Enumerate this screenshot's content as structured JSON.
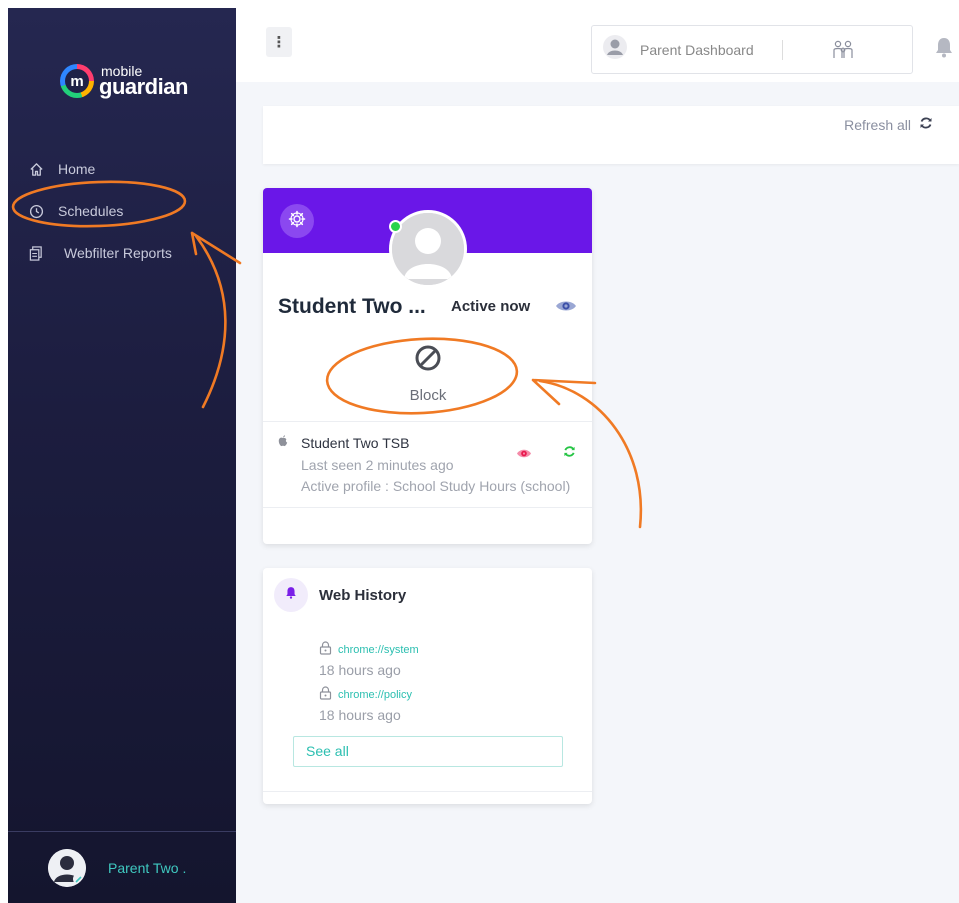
{
  "app": {
    "brand_line1": "mobile",
    "brand_line2": "guardian",
    "brand_mark": "m"
  },
  "sidebar": {
    "items": [
      {
        "label": "Home",
        "icon": "home-icon"
      },
      {
        "label": "Schedules",
        "icon": "clock-icon"
      },
      {
        "label": "Webfilter Reports",
        "icon": "reports-icon"
      }
    ],
    "footer_name": "Parent Two ."
  },
  "topbar": {
    "menu_glyph": "⋮",
    "dashboard_label": "Parent Dashboard"
  },
  "refresh": {
    "label": "Refresh all"
  },
  "student_card": {
    "name": "Student Two ...",
    "status": "Active now",
    "block_label": "Block",
    "device": {
      "name": "Student Two TSB",
      "last_seen": "Last seen 2 minutes ago",
      "active_profile": "Active profile : School Study Hours (school)"
    }
  },
  "web_history": {
    "title": "Web History",
    "items": [
      {
        "url": "chrome://system",
        "time": "18 hours ago"
      },
      {
        "url": "chrome://policy",
        "time": "18 hours ago"
      }
    ],
    "see_all": "See all"
  },
  "colors": {
    "sidebar_bg": "#1f2147",
    "banner_purple": "#6a17e8",
    "accent_teal": "#2bbfb0",
    "online_green": "#29d34a",
    "annotation_orange": "#f07a24"
  }
}
